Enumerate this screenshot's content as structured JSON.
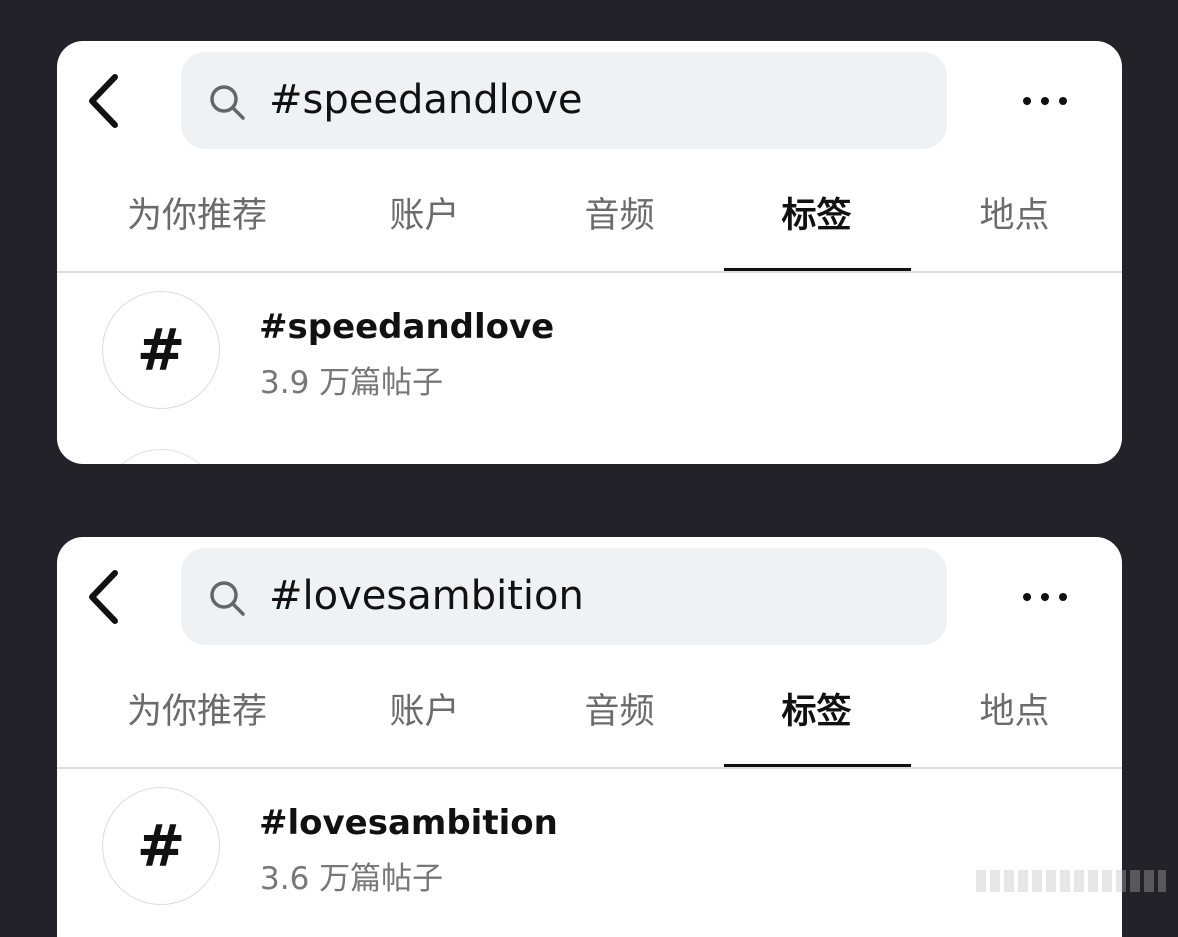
{
  "panels": [
    {
      "search": {
        "query": "#speedandlove"
      },
      "tabs": [
        "为你推荐",
        "账户",
        "音频",
        "标签",
        "地点"
      ],
      "active_tab": "标签",
      "result": {
        "symbol": "#",
        "title": "#speedandlove",
        "subtitle": "3.9 万篇帖子"
      }
    },
    {
      "search": {
        "query": "#lovesambition"
      },
      "tabs": [
        "为你推荐",
        "账户",
        "音频",
        "标签",
        "地点"
      ],
      "active_tab": "标签",
      "result": {
        "symbol": "#",
        "title": "#lovesambition",
        "subtitle": "3.6 万篇帖子"
      }
    }
  ],
  "icons": {
    "back": "chevron-left-icon",
    "search": "search-icon",
    "more": "more-horizontal-icon"
  },
  "colors": {
    "background": "#232228",
    "card": "#ffffff",
    "search_field": "#eff2f5",
    "active_tab": "#111111",
    "inactive_tab": "#6b6b6b"
  }
}
